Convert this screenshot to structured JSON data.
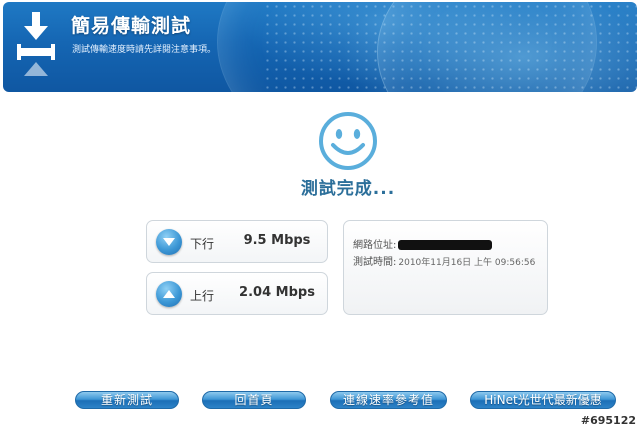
{
  "header": {
    "title": "簡易傳輸測試",
    "subtitle": "測試傳輸速度時請先詳閱注意事項。",
    "logo_icon": "transfer-arrows-icon"
  },
  "status": {
    "text": "測試完成...",
    "icon": "smiley-icon"
  },
  "speeds": {
    "download": {
      "label": "下行",
      "value": "9.5 Mbps",
      "icon": "chevron-down-icon"
    },
    "upload": {
      "label": "上行",
      "value": "2.04 Mbps",
      "icon": "chevron-up-icon"
    }
  },
  "info": {
    "ip_label": "網路位址:",
    "time_label": "測試時間:",
    "time_value": "2010年11月16日 上午 09:56:56"
  },
  "buttons": {
    "retest": "重新測試",
    "home": "回首頁",
    "reference": "連線速率參考值",
    "promo": "HiNet光世代最新優惠"
  },
  "watermark": "#695122",
  "colors": {
    "accent": "#1f79c4",
    "status_text": "#2c6f9a",
    "smiley": "#5aaedc"
  }
}
